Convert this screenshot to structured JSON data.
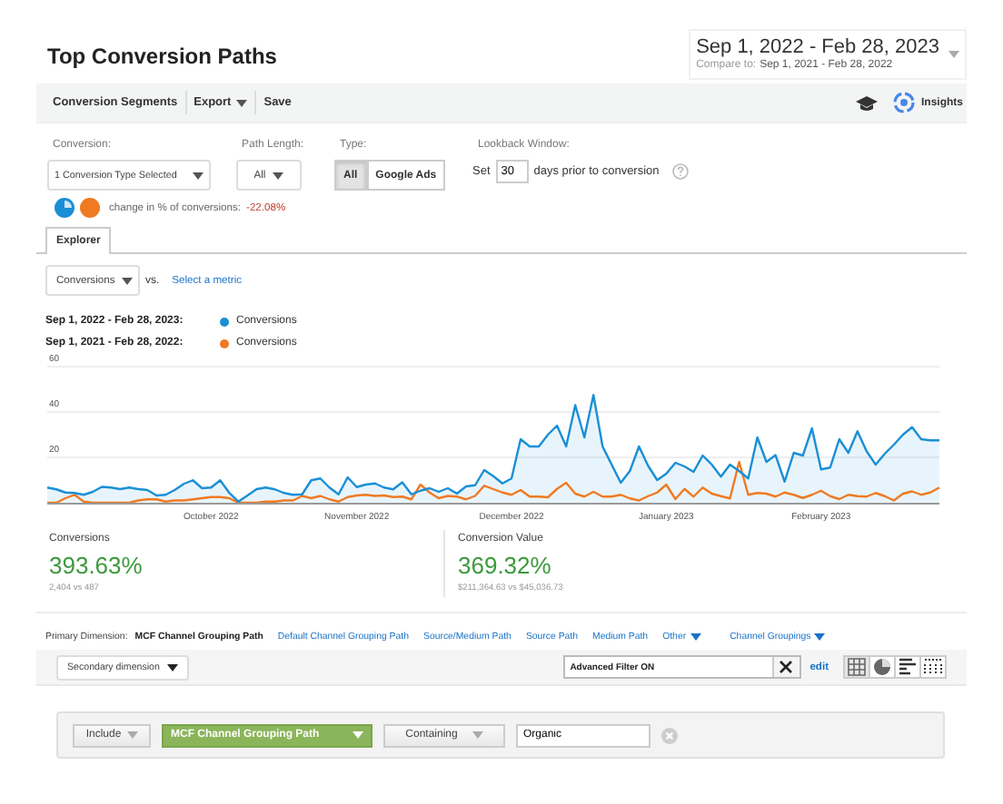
{
  "header": {
    "title": "Top Conversion Paths",
    "date_range": "Sep 1, 2022 - Feb 28, 2023",
    "compare_label": "Compare to:",
    "compare_range": "Sep 1, 2021 - Feb 28, 2022"
  },
  "toolbar": {
    "items": [
      {
        "label": "Conversion Segments",
        "kind": "plain"
      },
      {
        "label": "Export",
        "kind": "menu"
      },
      {
        "label": "Save",
        "kind": "plain"
      }
    ],
    "insights": "Insights"
  },
  "controls": {
    "conversion": {
      "label": "Conversion:",
      "value": "1 Conversion Type Selected"
    },
    "path_length": {
      "label": "Path Length:",
      "value": "All"
    },
    "type": {
      "label": "Type:",
      "options": [
        {
          "label": "All",
          "selected": true
        },
        {
          "label": "Google Ads",
          "selected": false
        }
      ]
    },
    "lookback": {
      "label": "Lookback Window:",
      "prefix": "Set",
      "value": "30",
      "suffix": "days prior to conversion"
    },
    "change": {
      "label": "change in % of conversions:",
      "value": "-22.08%"
    }
  },
  "tabs": [
    {
      "label": "Explorer",
      "selected": true
    }
  ],
  "metric": {
    "value": "Conversions",
    "vs": "vs.",
    "link": "Select a metric"
  },
  "legend": [
    {
      "metric": "Conversions"
    },
    {
      "metric": "Conversions"
    }
  ],
  "chart": {
    "chart_data": {
      "type": "line",
      "ylim": [
        0,
        60
      ],
      "yticks": [
        {
          "value": 20,
          "label": "20"
        },
        {
          "value": 40,
          "label": "40"
        },
        {
          "value": 60,
          "label": "60"
        }
      ],
      "categories": [
        null,
        null,
        null,
        null,
        null,
        null,
        null,
        null,
        null,
        null,
        null,
        null,
        null,
        null,
        null,
        null,
        null,
        null,
        "October 2022",
        null,
        null,
        null,
        null,
        null,
        null,
        null,
        null,
        null,
        null,
        null,
        null,
        null,
        null,
        null,
        "November 2022",
        null,
        null,
        null,
        null,
        null,
        null,
        null,
        null,
        null,
        null,
        null,
        null,
        null,
        null,
        null,
        null,
        "December 2022",
        null,
        null,
        null,
        null,
        null,
        null,
        null,
        null,
        null,
        null,
        null,
        null,
        null,
        null,
        null,
        null,
        "January 2023",
        null,
        null,
        null,
        null,
        null,
        null,
        null,
        null,
        null,
        null,
        null,
        null,
        null,
        null,
        null,
        null,
        "February 2023",
        null,
        null,
        null,
        null,
        null,
        null,
        null,
        null,
        null,
        null,
        null,
        null,
        null
      ],
      "series": [
        {
          "name": "Sep 1, 2022 - Feb 28, 2023:",
          "color": "#1a8fd6",
          "values": [
            6.7,
            5.9,
            4.5,
            4.3,
            3.5,
            4.8,
            7,
            6.7,
            6,
            6.7,
            6,
            5.6,
            3.2,
            3.5,
            5.6,
            8.3,
            9.9,
            6.4,
            6.7,
            9.9,
            4.3,
            0.5,
            3.2,
            6,
            6.7,
            5.9,
            4.3,
            3.5,
            3.7,
            9.9,
            10.7,
            6.7,
            3.7,
            11.2,
            6.9,
            8,
            8.5,
            6.7,
            5.9,
            9,
            3.7,
            5.3,
            6.4,
            4.8,
            6.4,
            4,
            7.2,
            7.7,
            14.4,
            11.7,
            8.5,
            10.7,
            28,
            24.8,
            24.8,
            30,
            34,
            24.8,
            43,
            28.8,
            47.5,
            24.8,
            16.8,
            8.8,
            14,
            24.8,
            16.3,
            10,
            12.8,
            17.6,
            16,
            13.6,
            20.8,
            16.8,
            11.5,
            16.8,
            14,
            10.7,
            28.8,
            18,
            21,
            9.3,
            22,
            20.8,
            32.8,
            14.7,
            15.5,
            28,
            22,
            31.5,
            22.7,
            16.8,
            21.6,
            25.6,
            30,
            33.3,
            28,
            27.5,
            27.5
          ]
        },
        {
          "name": "Sep 1, 2021 - Feb 28, 2022:",
          "color": "#f07a22",
          "values": [
            0,
            0,
            2,
            3.5,
            0.5,
            0,
            0,
            0,
            0,
            0,
            1,
            1.5,
            1.5,
            0.5,
            1,
            1,
            1.5,
            2,
            2.5,
            2.5,
            2,
            0,
            0,
            0,
            0.5,
            0.5,
            1,
            1,
            3,
            2,
            3,
            1.5,
            0.5,
            2.5,
            3.2,
            3.5,
            3,
            3.2,
            2.5,
            2.7,
            1.5,
            8,
            4.5,
            2,
            3,
            2.7,
            1.5,
            3,
            7.5,
            6,
            4.5,
            3.5,
            5.6,
            2.7,
            2.7,
            2.4,
            6.1,
            8.8,
            4,
            2.7,
            4.8,
            2.7,
            2.7,
            3.5,
            1.9,
            1,
            2.9,
            4.5,
            8,
            1.6,
            6.1,
            2.7,
            6.7,
            4,
            2.9,
            1.9,
            18,
            3.5,
            4.3,
            4,
            2.7,
            4.5,
            3.5,
            2.1,
            3.5,
            5.3,
            2.9,
            1.6,
            3.5,
            2.9,
            2.7,
            4.3,
            2.9,
            1,
            4,
            5,
            3.5,
            4.5,
            6.7
          ]
        }
      ]
    }
  },
  "summary": [
    {
      "label": "Conversions",
      "value": "393.63%",
      "detail": "2,404 vs 487"
    },
    {
      "label": "Conversion Value",
      "value": "369.32%",
      "detail": "$211,364.63 vs $45,036.73"
    }
  ],
  "dimensions": {
    "label": "Primary Dimension:",
    "items": [
      {
        "label": "MCF Channel Grouping Path",
        "selected": true,
        "kind": "link"
      },
      {
        "label": "Default Channel Grouping Path",
        "selected": false,
        "kind": "link"
      },
      {
        "label": "Source/Medium Path",
        "selected": false,
        "kind": "link"
      },
      {
        "label": "Source Path",
        "selected": false,
        "kind": "link"
      },
      {
        "label": "Medium Path",
        "selected": false,
        "kind": "link"
      },
      {
        "label": "Other",
        "selected": false,
        "kind": "menu"
      },
      {
        "label": "Channel Groupings",
        "selected": false,
        "kind": "menu"
      }
    ]
  },
  "table_bar": {
    "secondary": "Secondary dimension",
    "filter": "Advanced Filter ON",
    "edit": "edit",
    "views": [
      {
        "kind": "table",
        "selected": true
      },
      {
        "kind": "pie",
        "selected": false
      },
      {
        "kind": "bars",
        "selected": false
      },
      {
        "kind": "pivot",
        "selected": false
      }
    ]
  },
  "filter": {
    "include": "Include",
    "dimension": "MCF Channel Grouping Path",
    "match": "Containing",
    "value": "Organic"
  }
}
